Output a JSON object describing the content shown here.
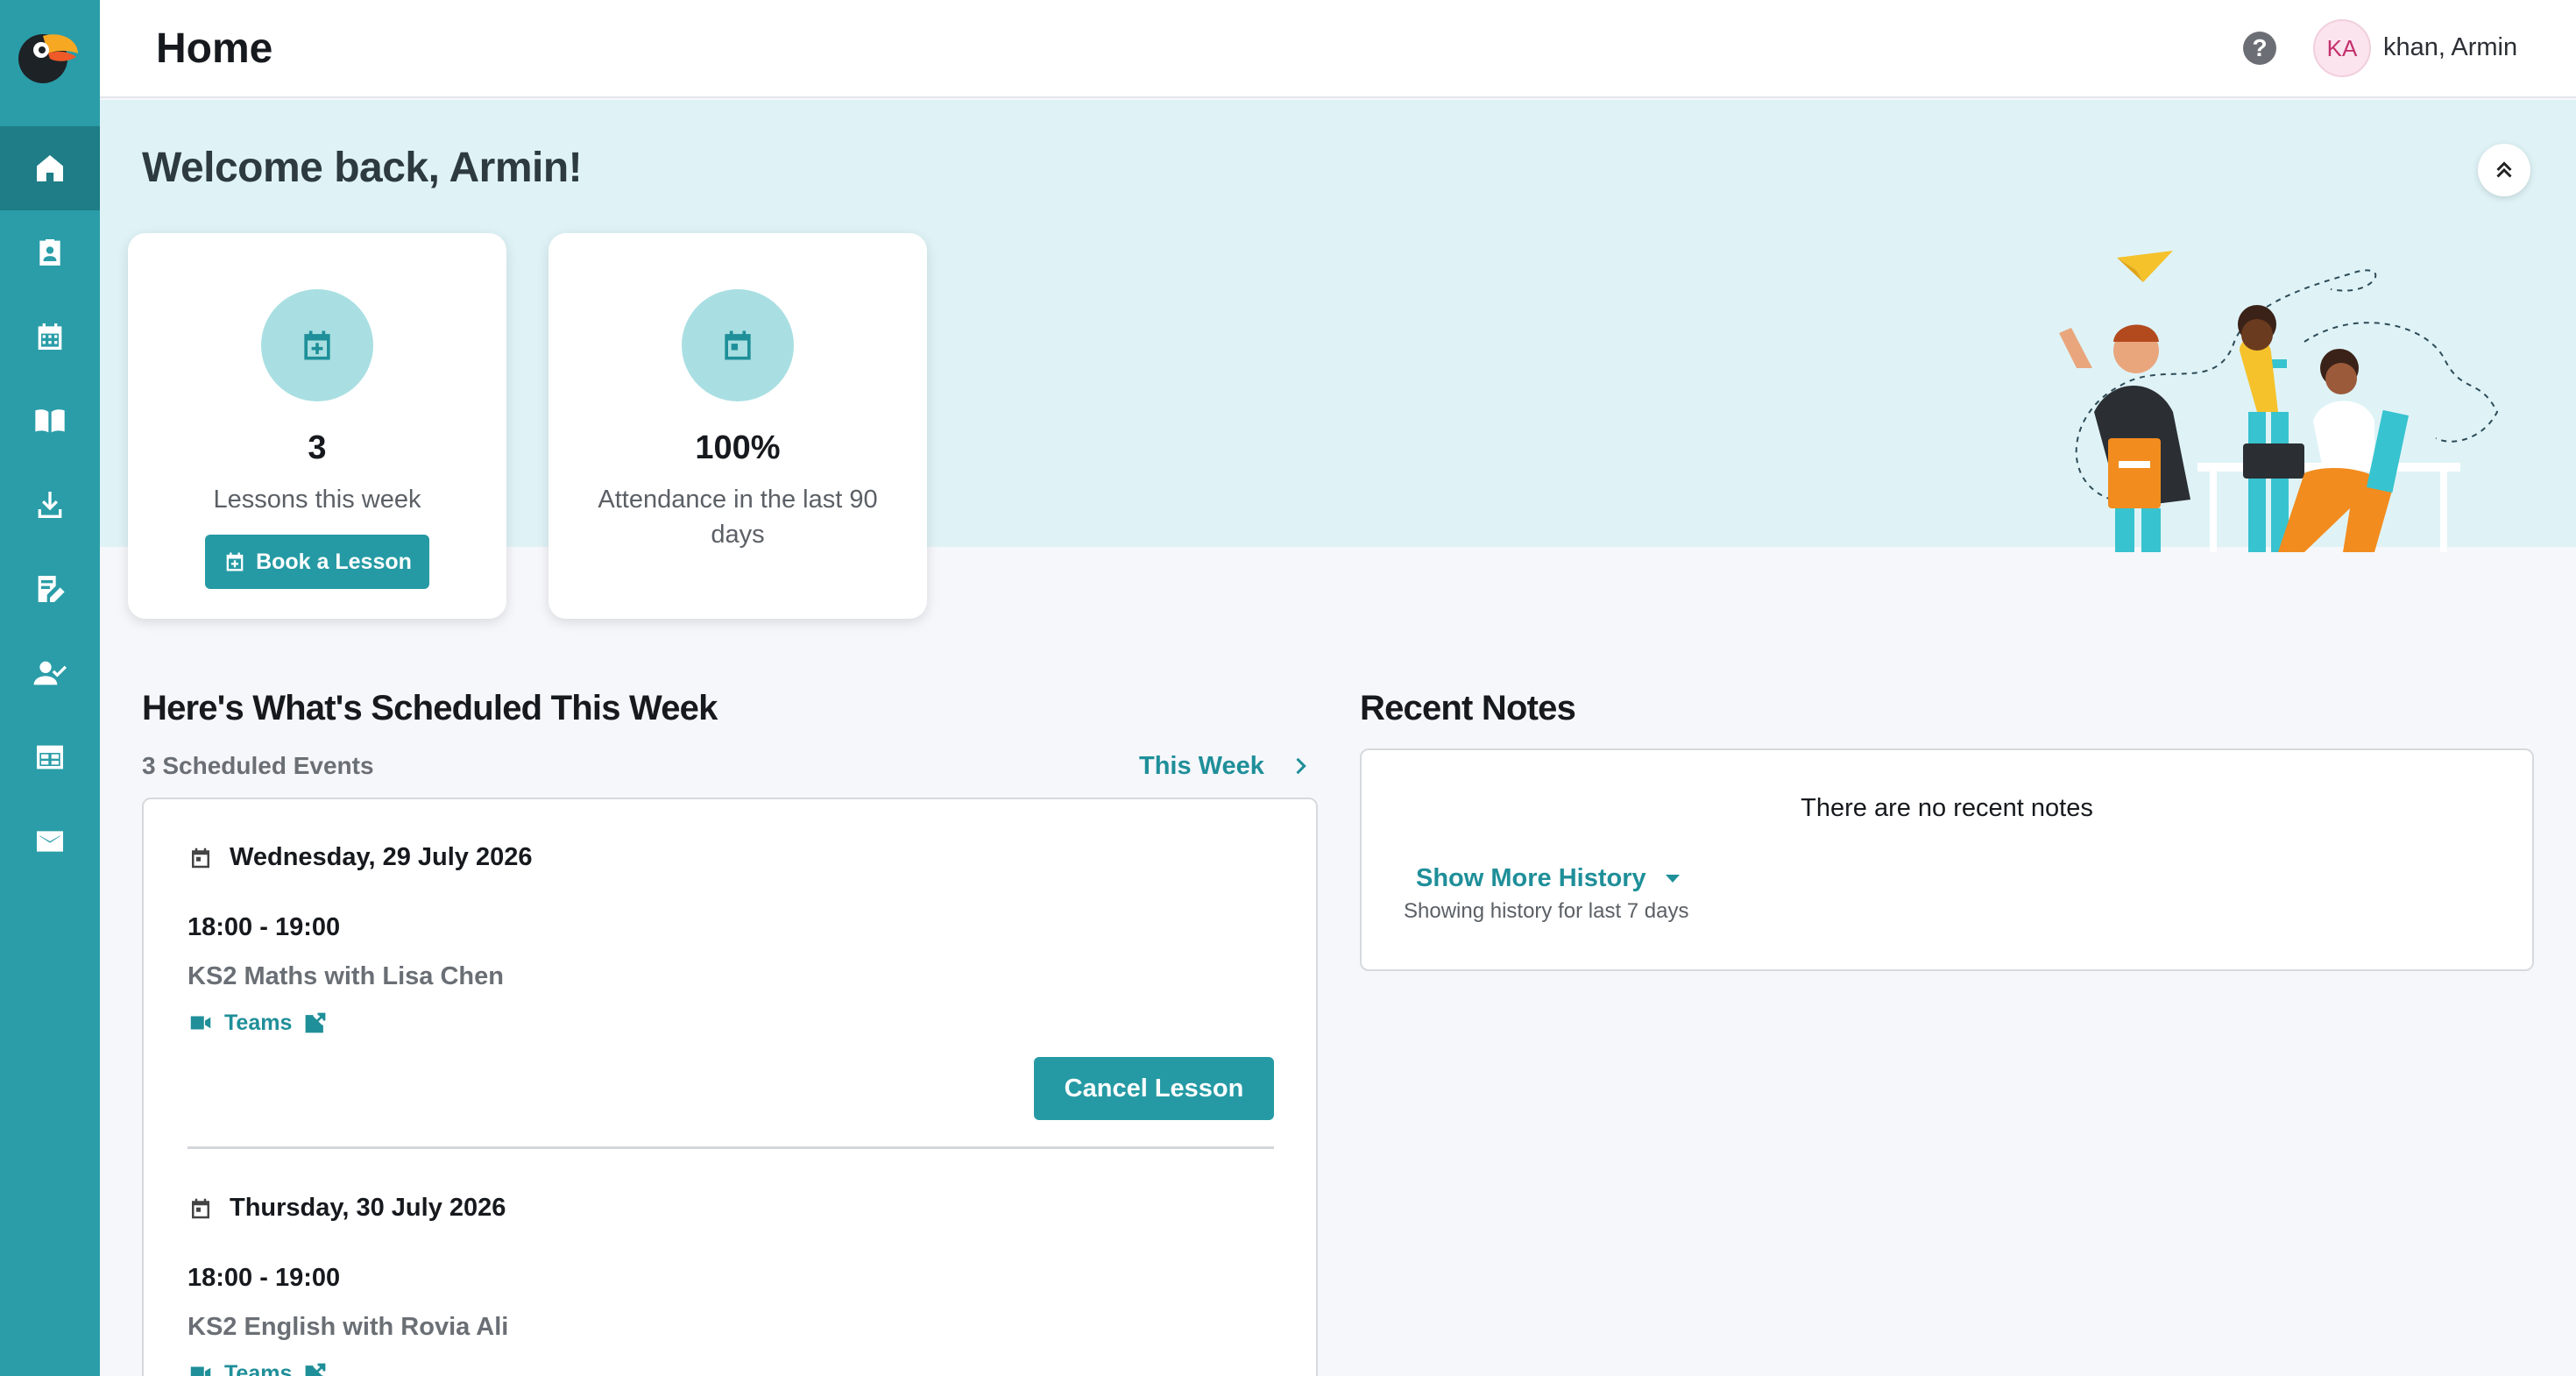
{
  "header": {
    "title": "Home",
    "help_icon": "help-circle-icon",
    "user_initials": "KA",
    "user_name": "khan, Armin"
  },
  "sidebar": {
    "items": [
      {
        "name": "home",
        "icon": "home-icon",
        "active": true
      },
      {
        "name": "students",
        "icon": "id-badge-icon"
      },
      {
        "name": "calendar",
        "icon": "calendar-icon"
      },
      {
        "name": "library",
        "icon": "book-open-icon"
      },
      {
        "name": "downloads",
        "icon": "download-icon"
      },
      {
        "name": "assignments",
        "icon": "edit-document-icon"
      },
      {
        "name": "attendance",
        "icon": "user-check-icon"
      },
      {
        "name": "timetable",
        "icon": "timetable-icon"
      },
      {
        "name": "messages",
        "icon": "mail-icon"
      }
    ]
  },
  "hero": {
    "welcome": "Welcome back, Armin!",
    "collapse_icon": "chevrons-up-icon"
  },
  "stats": [
    {
      "value": "3",
      "label": "Lessons this week",
      "icon": "calendar-plus-icon",
      "button": "Book a Lesson"
    },
    {
      "value": "100%",
      "label": "Attendance in the last 90 days",
      "icon": "calendar-event-icon"
    }
  ],
  "schedule": {
    "title": "Here's What's Scheduled This Week",
    "count": "3 Scheduled Events",
    "filter": "This Week",
    "events": [
      {
        "date": "Wednesday, 29 July 2026",
        "time": "18:00 - 19:00",
        "title": "KS2 Maths with Lisa Chen",
        "link": "Teams",
        "action": "Cancel Lesson"
      },
      {
        "date": "Thursday, 30 July 2026",
        "time": "18:00 - 19:00",
        "title": "KS2 English with Rovia Ali",
        "link": "Teams"
      }
    ]
  },
  "notes": {
    "title": "Recent Notes",
    "empty": "There are no recent notes",
    "show_more": "Show More History",
    "history_note": "Showing history for last 7 days"
  },
  "colors": {
    "sidebar": "#2a9da8",
    "sidebar_active": "#1e7d87",
    "accent": "#259aa4",
    "hero_bg": "#dff3f7"
  }
}
